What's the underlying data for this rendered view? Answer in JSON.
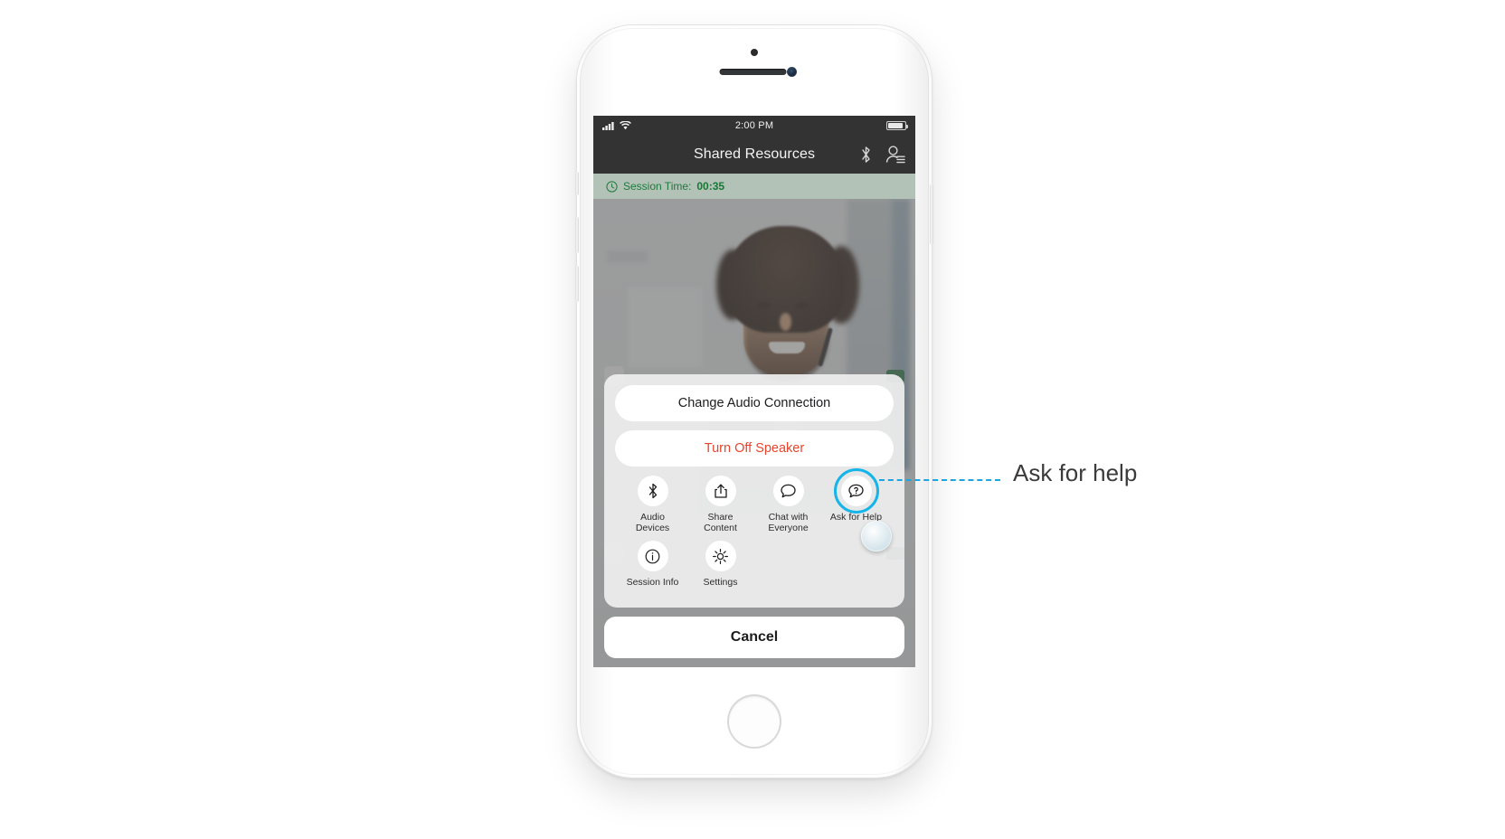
{
  "annotation": {
    "label": "Ask for help",
    "line_color": "#1ca5e0"
  },
  "phone": {
    "device_name": "iphone-white",
    "hardware": {
      "earpiece": "earpiece-speaker",
      "front_camera": "front-camera",
      "sensor": "proximity-sensor",
      "home_button": "home-button"
    }
  },
  "status_bar": {
    "signal": "signal-bars-icon",
    "wifi": "wifi-icon",
    "time": "2:00 PM",
    "battery": "battery-icon"
  },
  "nav_bar": {
    "title": "Shared Resources",
    "actions": [
      {
        "name": "bluetooth-icon",
        "label": "Bluetooth"
      },
      {
        "name": "participants-icon",
        "label": "Participants"
      }
    ]
  },
  "session_bar": {
    "icon": "clock-icon",
    "label": "Session Time:",
    "value": "00:35",
    "text_color": "#147a34",
    "background": "#b3c2b7"
  },
  "video": {
    "description": "remote-participant-video"
  },
  "action_sheet": {
    "buttons": [
      {
        "label": "Change Audio Connection",
        "style": "default"
      },
      {
        "label": "Turn Off Speaker",
        "style": "destructive"
      }
    ],
    "grid": [
      {
        "icon": "bluetooth-icon",
        "label": "Audio\nDevices",
        "line1": "Audio",
        "line2": "Devices",
        "highlighted": false
      },
      {
        "icon": "share-icon",
        "label": "Share\nContent",
        "line1": "Share",
        "line2": "Content",
        "highlighted": false
      },
      {
        "icon": "chat-icon",
        "label": "Chat with\nEveryone",
        "line1": "Chat with",
        "line2": "Everyone",
        "highlighted": false
      },
      {
        "icon": "question-chat-icon",
        "label": "Ask for Help",
        "line1": "Ask for Help",
        "line2": "",
        "highlighted": true
      },
      {
        "icon": "info-icon",
        "label": "Session Info",
        "line1": "Session Info",
        "line2": "",
        "highlighted": false
      },
      {
        "icon": "gear-icon",
        "label": "Settings",
        "line1": "Settings",
        "line2": "",
        "highlighted": false
      }
    ],
    "cancel_label": "Cancel",
    "highlight_color": "#15b4e9"
  }
}
